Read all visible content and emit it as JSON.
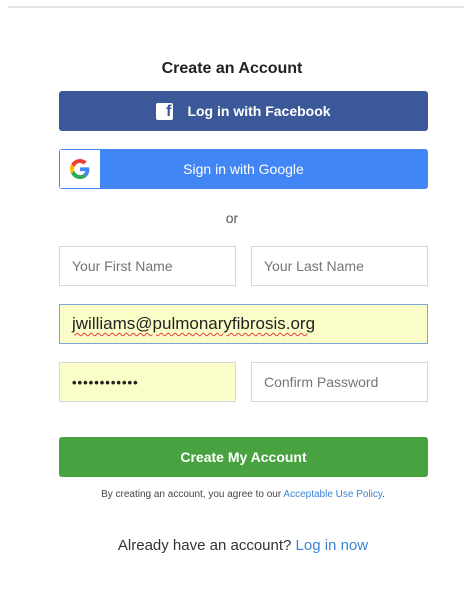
{
  "form": {
    "title": "Create an Account",
    "facebook_label": "Log in with Facebook",
    "google_label": "Sign in with Google",
    "or_text": "or",
    "first_name_placeholder": "Your First Name",
    "last_name_placeholder": "Your Last Name",
    "email_value": "jwilliams@pulmonaryfibrosis.org",
    "password_mask": "••••••••••••",
    "confirm_placeholder": "Confirm Password",
    "create_label": "Create My Account",
    "terms_prefix": "By creating an account, you agree to our ",
    "terms_link": "Acceptable Use Policy",
    "terms_suffix": ".",
    "already_text": "Already have an account? ",
    "login_link": "Log in now"
  },
  "colors": {
    "facebook": "#3b5998",
    "google": "#4285f4",
    "create": "#47a23f",
    "link": "#3a85d8",
    "autofill": "#fbfdc8"
  },
  "icons": {
    "facebook": "facebook-icon",
    "google": "google-icon"
  }
}
